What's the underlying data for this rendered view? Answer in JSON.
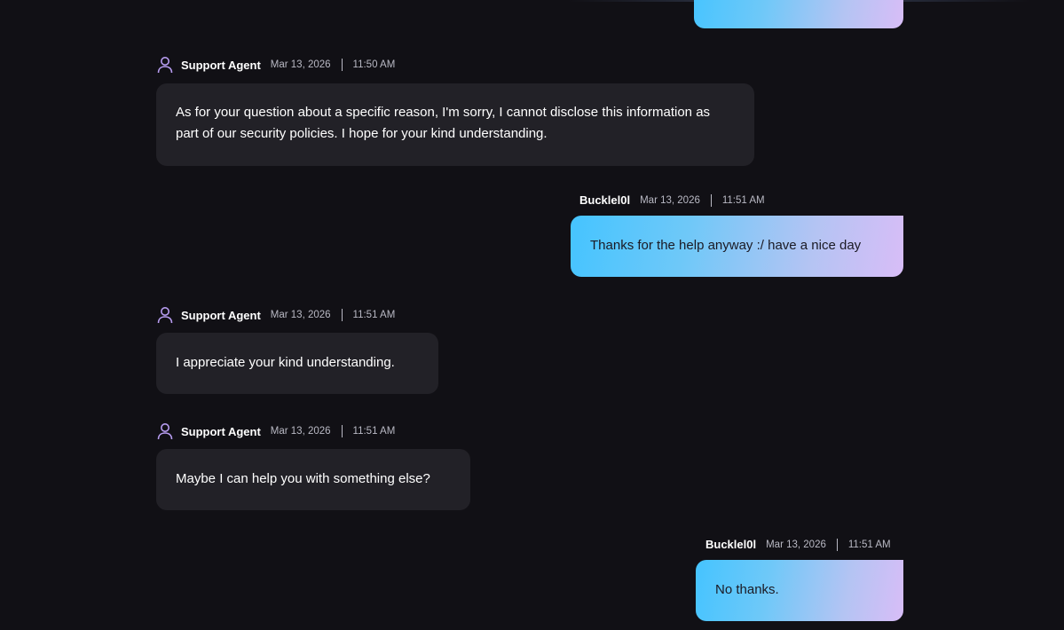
{
  "messages": [
    {
      "author": "Support Agent",
      "date": "Mar 13, 2026",
      "time": "11:50 AM",
      "text": "As for your question about a specific reason, I'm sorry, I cannot disclose this information as part of our security policies. I hope for your kind understanding."
    },
    {
      "author": "Bucklel0l",
      "date": "Mar 13, 2026",
      "time": "11:51 AM",
      "text": "Thanks for the help anyway :/ have a nice day"
    },
    {
      "author": "Support Agent",
      "date": "Mar 13, 2026",
      "time": "11:51 AM",
      "text": "I appreciate your kind understanding."
    },
    {
      "author": "Support Agent",
      "date": "Mar 13, 2026",
      "time": "11:51 AM",
      "text": "Maybe I can help you with something else?"
    },
    {
      "author": "Bucklel0l",
      "date": "Mar 13, 2026",
      "time": "11:51 AM",
      "text": "No thanks."
    }
  ],
  "colors": {
    "background": "#111015",
    "agent_bubble": "#222127",
    "user_gradient_start": "#45c4ff",
    "user_gradient_end": "#d8bdf7",
    "agent_icon": "#b79cf0"
  },
  "icons": {
    "agent_avatar": "user-icon"
  }
}
